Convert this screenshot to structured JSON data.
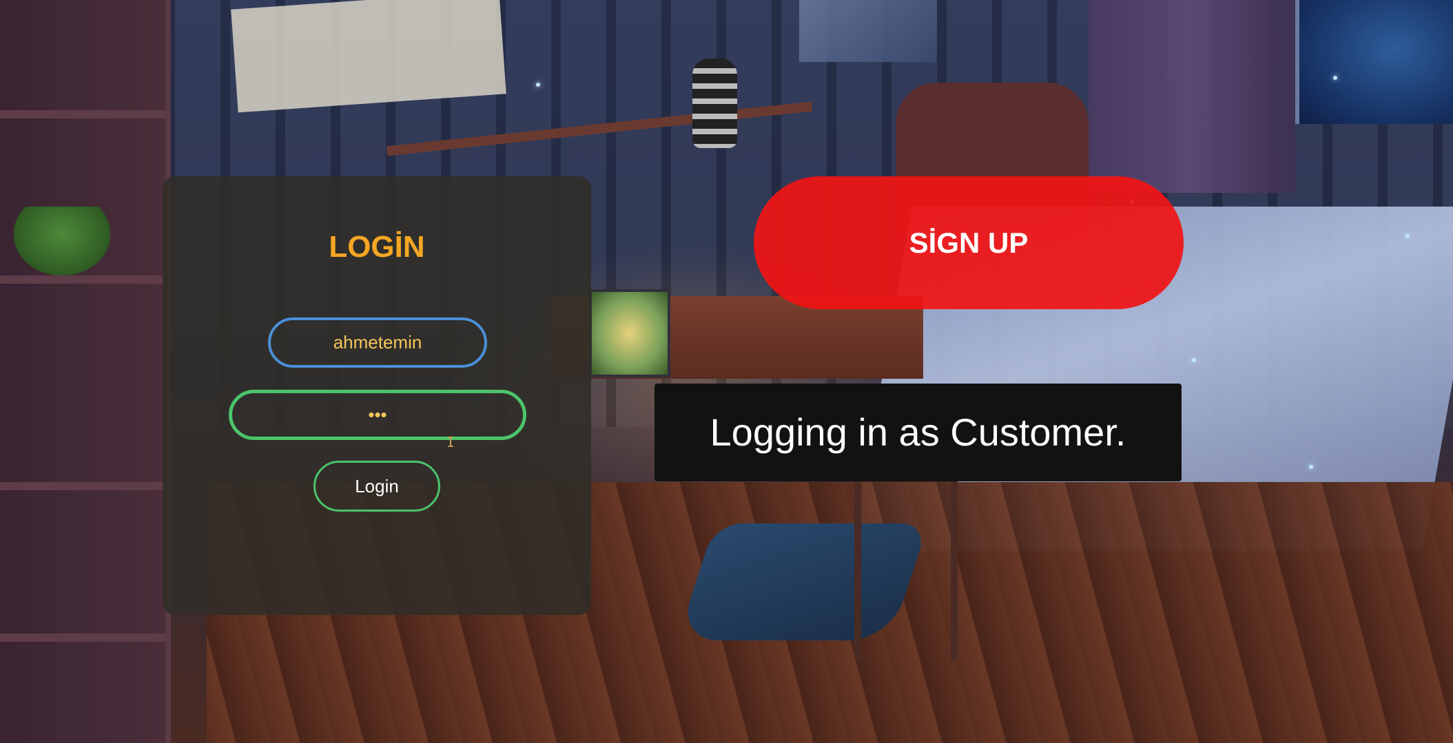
{
  "login": {
    "title": "LOGİN",
    "username_value": "ahmetemin",
    "password_value": "•••",
    "button_label": "Login"
  },
  "signup": {
    "button_label": "SİGN UP"
  },
  "toast": {
    "message": "Logging in as Customer."
  },
  "colors": {
    "login_title": "#f5a623",
    "username_border": "#4a90d9",
    "password_border": "#4cc46a",
    "login_button_border": "#4cc46a",
    "signup_bg": "#f01414",
    "toast_bg": "#121212"
  }
}
